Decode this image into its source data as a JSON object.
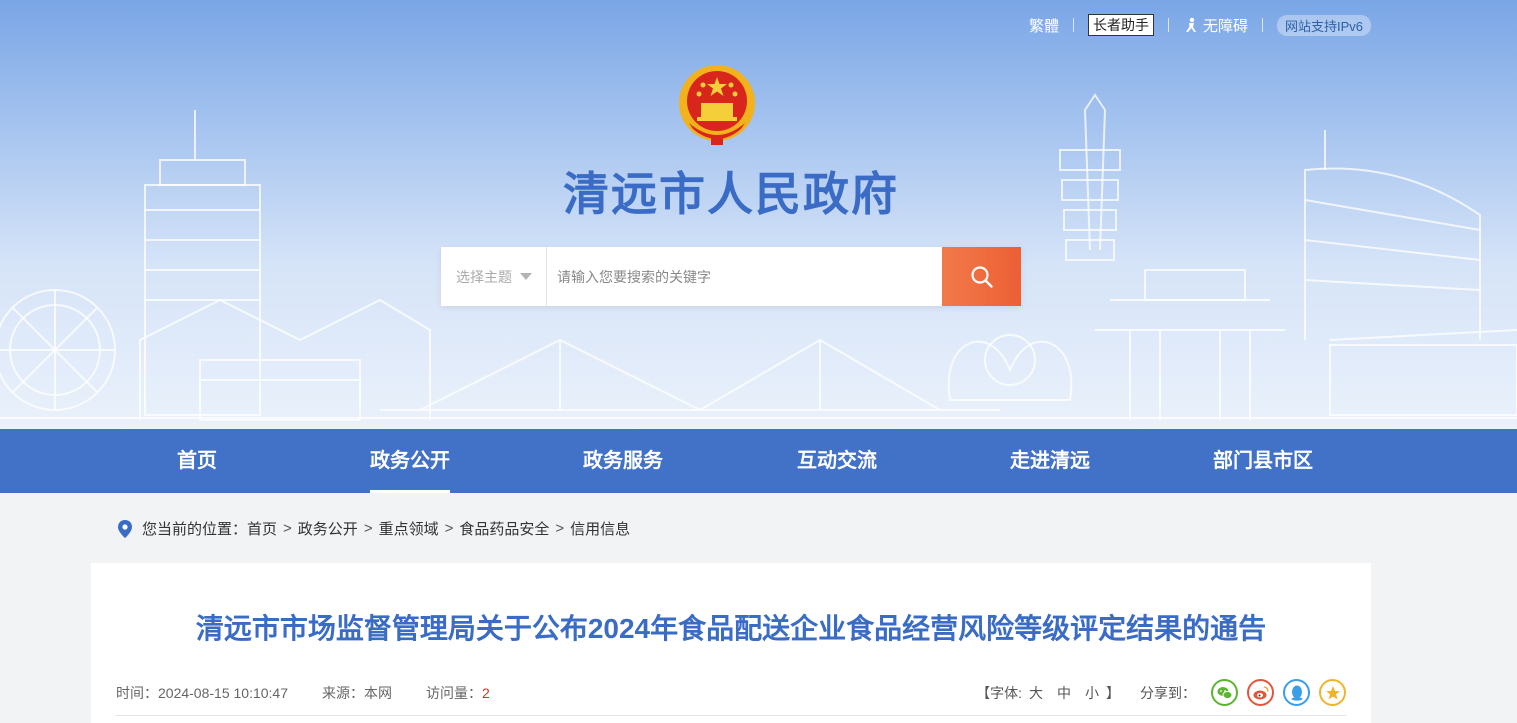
{
  "topbar": {
    "traditional": "繁體",
    "elder": "长者助手",
    "accessible": "无障碍",
    "ipv6": "网站支持IPv6"
  },
  "site": {
    "title": "清远市人民政府"
  },
  "search": {
    "topic_label": "选择主题",
    "placeholder": "请输入您要搜索的关键字",
    "button_icon": "search-icon"
  },
  "nav": {
    "items": [
      {
        "label": "首页"
      },
      {
        "label": "政务公开",
        "active": true
      },
      {
        "label": "政务服务"
      },
      {
        "label": "互动交流"
      },
      {
        "label": "走进清远"
      },
      {
        "label": "部门县市区"
      }
    ]
  },
  "breadcrumb": {
    "prefix": "您当前的位置：",
    "items": [
      "首页",
      "政务公开",
      "重点领域",
      "食品药品安全",
      "信用信息"
    ],
    "separator": ">"
  },
  "article": {
    "title": "清远市市场监督管理局关于公布2024年食品配送企业食品经营风险等级评定结果的通告",
    "time_label": "时间：",
    "time": "2024-08-15 10:10:47",
    "source_label": "来源：",
    "source": "本网",
    "views_label": "访问量：",
    "views": "2",
    "font_label": "【字体:",
    "font_large": "大",
    "font_medium": "中",
    "font_small": "小",
    "font_close": "】",
    "share_label": "分享到："
  },
  "colors": {
    "brand_blue": "#4271c8",
    "title_blue": "#3a6cc6",
    "search_orange": "#ec5f34",
    "wechat": "#5cb531",
    "weibo": "#e2563b",
    "qq": "#3a9ee8",
    "qzone": "#f0b429"
  },
  "share_icons": [
    "wechat-icon",
    "weibo-icon",
    "qq-icon",
    "qzone-icon"
  ]
}
